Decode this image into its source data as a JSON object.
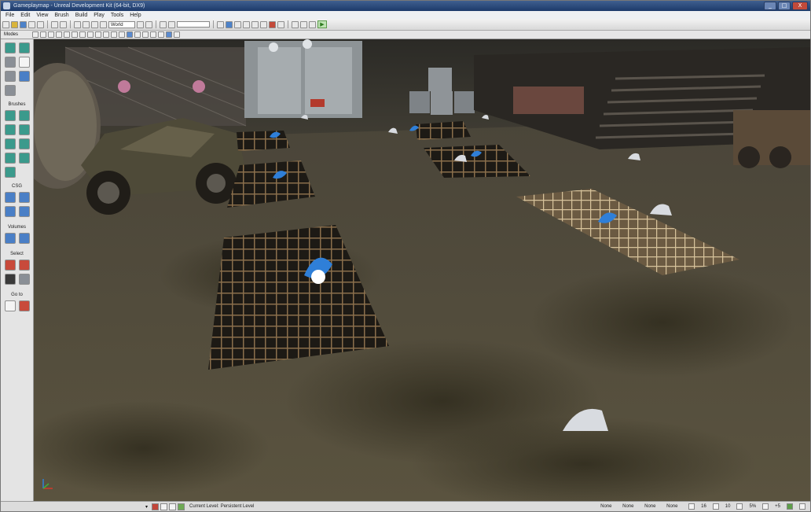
{
  "window": {
    "title": "Gameplaymap - Unreal Development Kit (64-bit, DX9)",
    "controls": {
      "minimize": "_",
      "maximize": "□",
      "close": "X"
    }
  },
  "menu": {
    "items": [
      "File",
      "Edit",
      "View",
      "Brush",
      "Build",
      "Play",
      "Tools",
      "Help"
    ]
  },
  "toolbar": {
    "world_combo": "World",
    "play_glyph": "▶"
  },
  "modes": {
    "label": "Modes"
  },
  "left_panel": {
    "sections": [
      "Brushes",
      "CSG",
      "Volumes",
      "Select",
      "Go to"
    ]
  },
  "status": {
    "arrow": "▾",
    "level_label": "Current Level:",
    "level_value": "Persistent Level",
    "cells": [
      "None",
      "None",
      "None",
      "None"
    ],
    "grid_value": "16",
    "rotation_value": "10",
    "scale_value": "5%",
    "extra_value": "+5"
  },
  "colors": {
    "accent": "#2f7fd8",
    "title_bar": "#2a4a7a",
    "panel_bg": "#e4e4e4"
  }
}
